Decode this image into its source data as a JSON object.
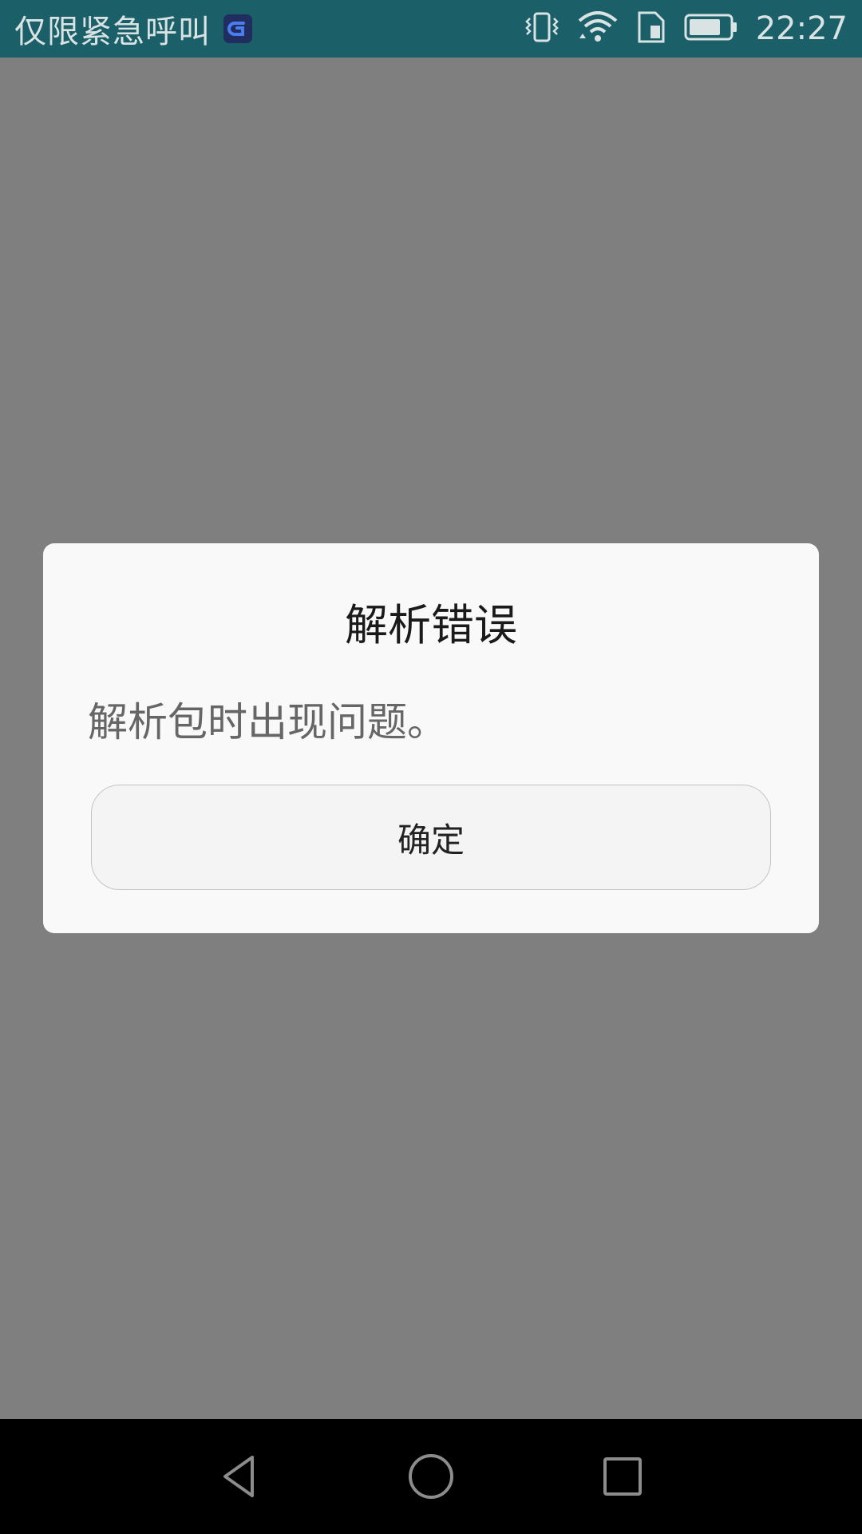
{
  "status_bar": {
    "carrier_text": "仅限紧急呼叫",
    "time": "22:27",
    "icons": [
      "app-notification-icon",
      "vibrate-icon",
      "wifi-icon",
      "sim-icon",
      "battery-icon"
    ]
  },
  "dialog": {
    "title": "解析错误",
    "message": "解析包时出现问题。",
    "ok_label": "确定"
  },
  "nav_bar": {
    "icons": [
      "back-icon",
      "home-icon",
      "recents-icon"
    ]
  }
}
